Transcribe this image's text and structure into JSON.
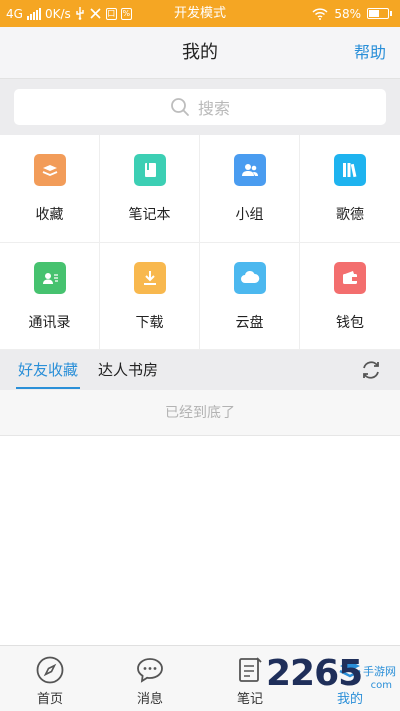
{
  "status_bar": {
    "network": "4G",
    "speed": "0K/s",
    "mode": "开发模式",
    "battery": "58%",
    "battery_level": 0.58
  },
  "header": {
    "title": "我的",
    "help": "帮助"
  },
  "search": {
    "placeholder": "搜索"
  },
  "grid": {
    "items": [
      {
        "label": "收藏",
        "icon": "favorites-icon",
        "color": "#f29c59"
      },
      {
        "label": "笔记本",
        "icon": "notebook-icon",
        "color": "#3ccfb4"
      },
      {
        "label": "小组",
        "icon": "group-icon",
        "color": "#4a9cf0"
      },
      {
        "label": "歌德",
        "icon": "books-icon",
        "color": "#1eb3ef"
      },
      {
        "label": "通讯录",
        "icon": "contacts-icon",
        "color": "#46c26f"
      },
      {
        "label": "下载",
        "icon": "download-icon",
        "color": "#f8b84e"
      },
      {
        "label": "云盘",
        "icon": "cloud-icon",
        "color": "#4cb8ef"
      },
      {
        "label": "钱包",
        "icon": "wallet-icon",
        "color": "#f36e6e"
      }
    ]
  },
  "tabs": {
    "friends": "好友收藏",
    "expert": "达人书房"
  },
  "list": {
    "end_text": "已经到底了"
  },
  "bottom_nav": {
    "items": [
      {
        "label": "首页",
        "icon": "compass-icon"
      },
      {
        "label": "消息",
        "icon": "message-icon"
      },
      {
        "label": "笔记",
        "icon": "note-icon"
      },
      {
        "label": "我的",
        "icon": "me-icon"
      }
    ]
  },
  "watermark": {
    "number": "2265",
    "text": "手游网",
    "domain": "com"
  },
  "colors": {
    "accent": "#2a8fd8",
    "status_bar": "#f5a623"
  }
}
